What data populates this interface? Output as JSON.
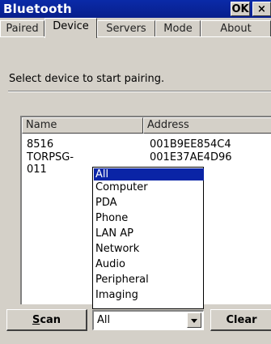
{
  "window": {
    "title": "Bluetooth",
    "ok_label": "OK",
    "close_label": "×"
  },
  "tabs": [
    {
      "label": "Paired"
    },
    {
      "label": "Device",
      "active": true
    },
    {
      "label": "Servers"
    },
    {
      "label": "Mode"
    },
    {
      "label": "About"
    }
  ],
  "instruction": "Select device to start pairing.",
  "list": {
    "columns": {
      "name": "Name",
      "address": "Address"
    },
    "rows": [
      {
        "name": "8516",
        "address": "001B9EE854C4"
      },
      {
        "name": "TORPSG-011",
        "address": "001E37AE4D96"
      }
    ]
  },
  "filter": {
    "selected": "All",
    "options": [
      "All",
      "Computer",
      "PDA",
      "Phone",
      "LAN AP",
      "Network",
      "Audio",
      "Peripheral",
      "Imaging"
    ]
  },
  "buttons": {
    "scan_first": "S",
    "scan_rest": "can",
    "clear": "Clear"
  }
}
